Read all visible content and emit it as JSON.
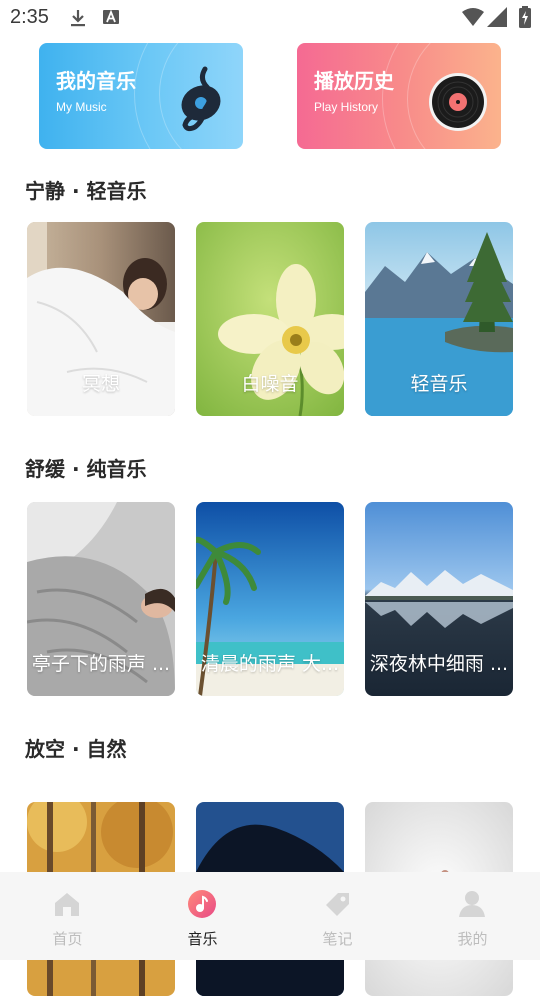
{
  "status_bar": {
    "time": "2:35"
  },
  "top_cards": {
    "music": {
      "title": "我的音乐",
      "subtitle": "My Music"
    },
    "history": {
      "title": "播放历史",
      "subtitle": "Play History"
    }
  },
  "sections": [
    {
      "title": "宁静 · 轻音乐",
      "tiles": [
        {
          "label": "冥想"
        },
        {
          "label": "白噪音"
        },
        {
          "label": "轻音乐"
        }
      ]
    },
    {
      "title": "舒缓 · 纯音乐",
      "tiles": [
        {
          "label": "亭子下的雨声 ..."
        },
        {
          "label": "清晨的雨声 大..."
        },
        {
          "label": "深夜林中细雨 ..."
        }
      ]
    },
    {
      "title": "放空 · 自然",
      "tiles": [
        {
          "label": ""
        },
        {
          "label": ""
        },
        {
          "label": ""
        }
      ]
    }
  ],
  "bottom_nav": {
    "items": [
      {
        "label": "首页",
        "icon": "home-icon"
      },
      {
        "label": "音乐",
        "icon": "music-note-icon"
      },
      {
        "label": "笔记",
        "icon": "note-tag-icon"
      },
      {
        "label": "我的",
        "icon": "profile-icon"
      }
    ],
    "active_index": 1,
    "accent": "#f25c78"
  }
}
